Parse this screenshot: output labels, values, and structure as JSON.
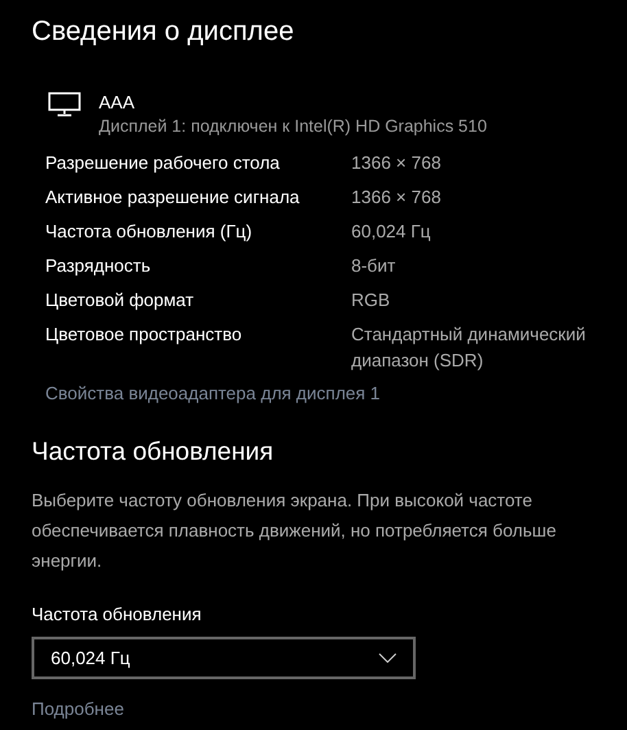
{
  "title": "Сведения о дисплее",
  "display": {
    "name": "AAA",
    "subtitle": "Дисплей 1: подключен к Intel(R) HD Graphics 510"
  },
  "properties": [
    {
      "label": "Разрешение рабочего стола",
      "value": "1366 × 768"
    },
    {
      "label": "Активное разрешение сигнала",
      "value": "1366 × 768"
    },
    {
      "label": "Частота обновления (Гц)",
      "value": "60,024 Гц"
    },
    {
      "label": "Разрядность",
      "value": "8-бит"
    },
    {
      "label": "Цветовой формат",
      "value": "RGB"
    },
    {
      "label": "Цветовое пространство",
      "value": "Стандартный динамический диапазон (SDR)"
    }
  ],
  "adapter_link": "Свойства видеоадаптера для дисплея 1",
  "refresh_section": {
    "heading": "Частота обновления",
    "description": "Выберите частоту обновления экрана. При высокой частоте обеспечивается плавность движений, но потребляется больше энергии.",
    "dropdown_label": "Частота обновления",
    "dropdown_value": "60,024 Гц",
    "more_link": "Подробнее"
  }
}
